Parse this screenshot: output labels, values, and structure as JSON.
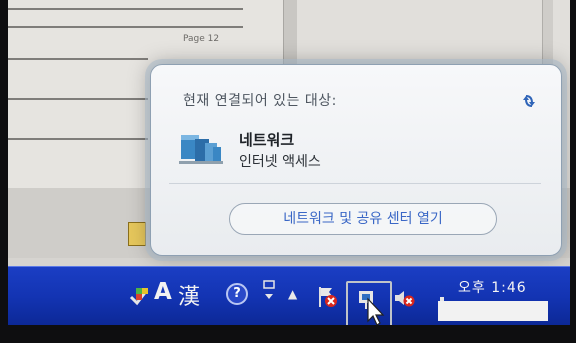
{
  "document": {
    "page_label": "Page 12"
  },
  "popup": {
    "title": "현재 연결되어 있는 대상:",
    "network_name": "네트워크",
    "network_status": "인터넷 액세스",
    "open_center_label": "네트워크 및 공유 센터 열기"
  },
  "taskbar": {
    "ime_mode": "A",
    "ime_hanja": "漢",
    "help": "?",
    "clock": "오후 1:46"
  },
  "icons": {
    "refresh": "refresh-icon",
    "network": "network-icon",
    "language": "language-bar-icon",
    "help": "help-icon",
    "flag": "action-center-icon",
    "network_tray": "network-tray-icon",
    "volume": "volume-muted-icon"
  },
  "colors": {
    "taskbar": "#1334b3",
    "link": "#3a67c6",
    "error_badge": "#d9261c"
  }
}
